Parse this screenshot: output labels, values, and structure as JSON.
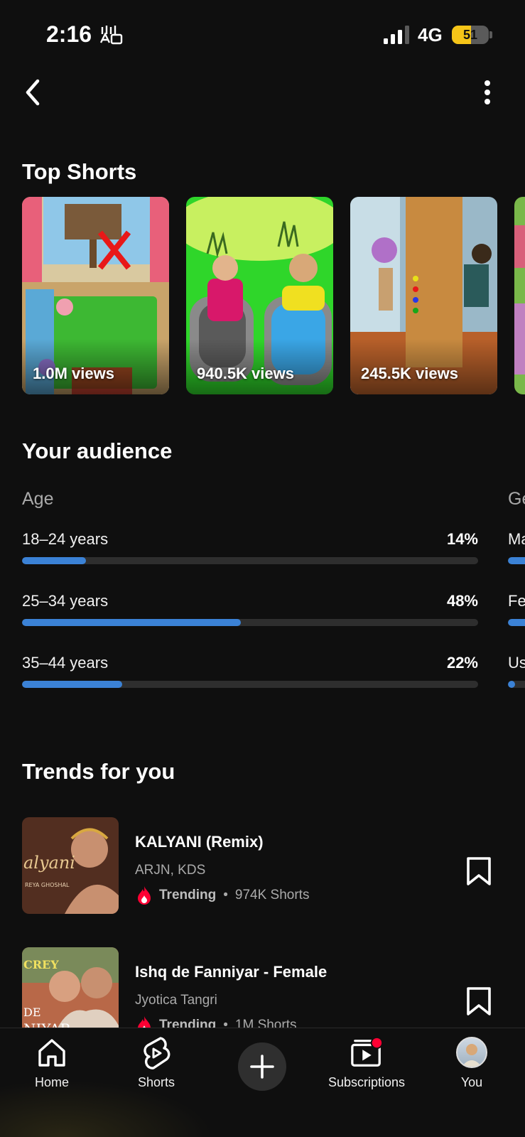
{
  "status_bar": {
    "time": "2:16",
    "network": "4G",
    "battery": "51"
  },
  "top_shorts": {
    "title": "Top Shorts",
    "items": [
      {
        "views": "1.0M views",
        "icon": "classroom-cartoon-thumbnail"
      },
      {
        "views": "940.5K views",
        "icon": "bathtub-cartoon-thumbnail"
      },
      {
        "views": "245.5K views",
        "icon": "door-kick-cartoon-thumbnail"
      }
    ]
  },
  "audience": {
    "title": "Your audience",
    "age_title": "Age",
    "age_groups": [
      {
        "label": "18–24 years",
        "percent": "14%",
        "value": 14
      },
      {
        "label": "25–34 years",
        "percent": "48%",
        "value": 48
      },
      {
        "label": "35–44 years",
        "percent": "22%",
        "value": 22
      }
    ],
    "gender_title_partial": "Ge",
    "gender_rows_partial": [
      "Ma",
      "Fe",
      "Us"
    ]
  },
  "trends": {
    "title": "Trends for you",
    "items": [
      {
        "title": "KALYANI (Remix)",
        "artist": "ARJN, KDS",
        "status": "Trending",
        "count": "974K Shorts"
      },
      {
        "title": "Ishq de Fanniyar - Female",
        "artist": "Jyotica Tangri",
        "status": "Trending",
        "count": "1M Shorts"
      }
    ]
  },
  "bottom_nav": {
    "items": [
      {
        "label": "Home",
        "icon": "home-icon"
      },
      {
        "label": "Shorts",
        "icon": "shorts-icon"
      },
      {
        "label": "",
        "icon": "create-plus-icon"
      },
      {
        "label": "Subscriptions",
        "icon": "subscriptions-icon"
      },
      {
        "label": "You",
        "icon": "avatar"
      }
    ]
  },
  "colors": {
    "background": "#0f0f0f",
    "bar": "#3b82d6",
    "trending_red": "#ff0033",
    "battery": "#f5c518"
  }
}
